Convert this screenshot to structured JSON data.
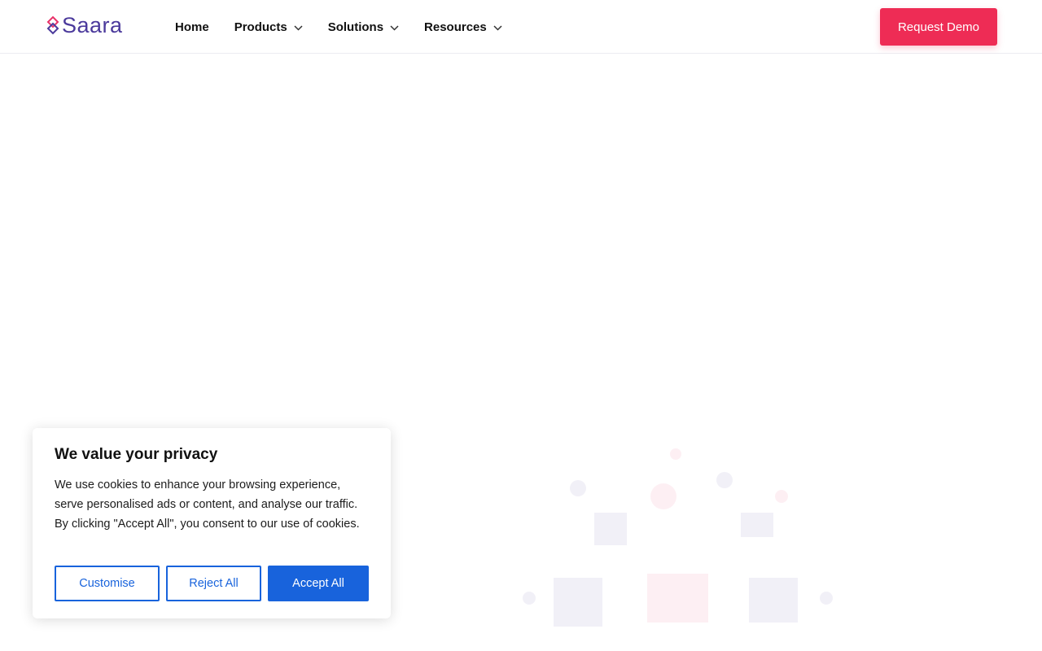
{
  "brand": {
    "name": "Saara",
    "primary_color": "#4b3a9c",
    "accent_color": "#ee2c55"
  },
  "nav": {
    "items": [
      {
        "label": "Home",
        "has_dropdown": false
      },
      {
        "label": "Products",
        "has_dropdown": true
      },
      {
        "label": "Solutions",
        "has_dropdown": true
      },
      {
        "label": "Resources",
        "has_dropdown": true
      }
    ],
    "cta_label": "Request Demo"
  },
  "cookie_banner": {
    "title": "We value your privacy",
    "body": "We use cookies to enhance your browsing experience, serve personalised ads or content, and analyse our traffic. By clicking \"Accept All\", you consent to our use of cookies.",
    "customise_label": "Customise",
    "reject_label": "Reject All",
    "accept_label": "Accept All",
    "button_color": "#1863dc"
  }
}
